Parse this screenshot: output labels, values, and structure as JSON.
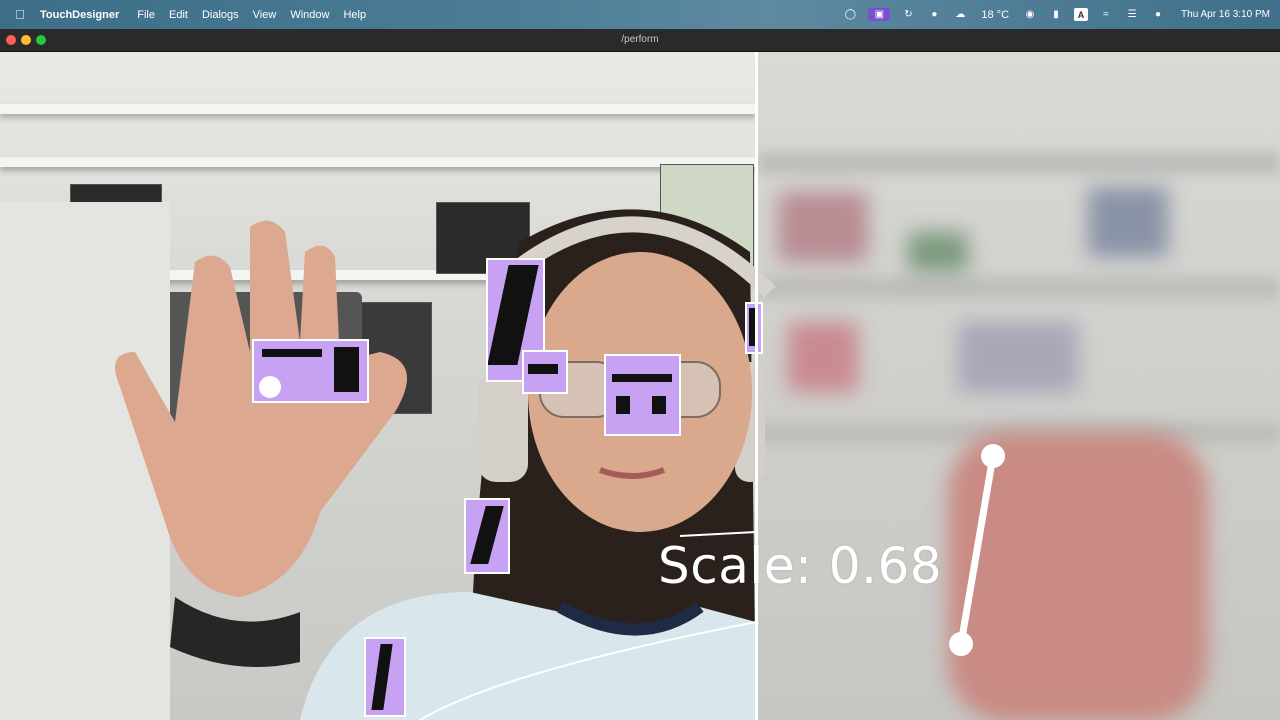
{
  "menubar": {
    "apple_icon": "apple-logo-icon",
    "app_name": "TouchDesigner",
    "menus": [
      "File",
      "Edit",
      "Dialogs",
      "View",
      "Window",
      "Help"
    ],
    "status_icons": [
      "control-center-icon",
      "screen-record-icon",
      "sync-icon",
      "chat-icon",
      "cloud-icon"
    ],
    "weather": "18 °C",
    "input_source": "A",
    "clock": "Thu Apr 16  3:10 PM"
  },
  "window": {
    "title": "/perform"
  },
  "overlay": {
    "scale_label": "Scale: 0.68",
    "scale_value": 0.68,
    "accent_color": "#c8a2f2",
    "line_color": "#ffffff"
  }
}
